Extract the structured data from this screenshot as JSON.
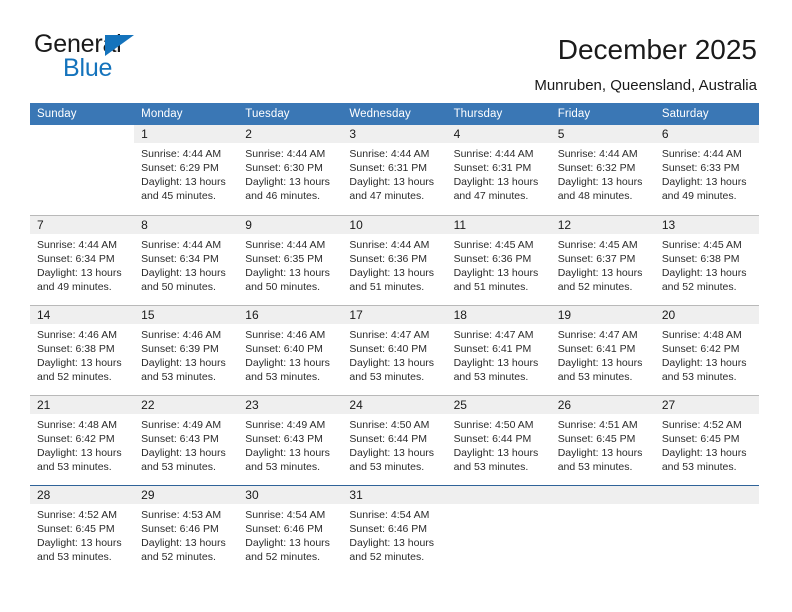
{
  "brand": {
    "name_top": "General",
    "name_bottom": "Blue",
    "triangle_color": "#1473bc"
  },
  "header": {
    "title": "December 2025",
    "location": "Munruben, Queensland, Australia",
    "accent_color": "#3a77b5"
  },
  "weekday_headers": [
    "Sunday",
    "Monday",
    "Tuesday",
    "Wednesday",
    "Thursday",
    "Friday",
    "Saturday"
  ],
  "labels": {
    "sunrise": "Sunrise:",
    "sunset": "Sunset:",
    "daylight": "Daylight:"
  },
  "weeks": [
    [
      {
        "day": "",
        "blank": true
      },
      {
        "day": "1",
        "sunrise": "Sunrise: 4:44 AM",
        "sunset": "Sunset: 6:29 PM",
        "daylight_1": "Daylight: 13 hours",
        "daylight_2": "and 45 minutes."
      },
      {
        "day": "2",
        "sunrise": "Sunrise: 4:44 AM",
        "sunset": "Sunset: 6:30 PM",
        "daylight_1": "Daylight: 13 hours",
        "daylight_2": "and 46 minutes."
      },
      {
        "day": "3",
        "sunrise": "Sunrise: 4:44 AM",
        "sunset": "Sunset: 6:31 PM",
        "daylight_1": "Daylight: 13 hours",
        "daylight_2": "and 47 minutes."
      },
      {
        "day": "4",
        "sunrise": "Sunrise: 4:44 AM",
        "sunset": "Sunset: 6:31 PM",
        "daylight_1": "Daylight: 13 hours",
        "daylight_2": "and 47 minutes."
      },
      {
        "day": "5",
        "sunrise": "Sunrise: 4:44 AM",
        "sunset": "Sunset: 6:32 PM",
        "daylight_1": "Daylight: 13 hours",
        "daylight_2": "and 48 minutes."
      },
      {
        "day": "6",
        "sunrise": "Sunrise: 4:44 AM",
        "sunset": "Sunset: 6:33 PM",
        "daylight_1": "Daylight: 13 hours",
        "daylight_2": "and 49 minutes."
      }
    ],
    [
      {
        "day": "7",
        "sunrise": "Sunrise: 4:44 AM",
        "sunset": "Sunset: 6:34 PM",
        "daylight_1": "Daylight: 13 hours",
        "daylight_2": "and 49 minutes."
      },
      {
        "day": "8",
        "sunrise": "Sunrise: 4:44 AM",
        "sunset": "Sunset: 6:34 PM",
        "daylight_1": "Daylight: 13 hours",
        "daylight_2": "and 50 minutes."
      },
      {
        "day": "9",
        "sunrise": "Sunrise: 4:44 AM",
        "sunset": "Sunset: 6:35 PM",
        "daylight_1": "Daylight: 13 hours",
        "daylight_2": "and 50 minutes."
      },
      {
        "day": "10",
        "sunrise": "Sunrise: 4:44 AM",
        "sunset": "Sunset: 6:36 PM",
        "daylight_1": "Daylight: 13 hours",
        "daylight_2": "and 51 minutes."
      },
      {
        "day": "11",
        "sunrise": "Sunrise: 4:45 AM",
        "sunset": "Sunset: 6:36 PM",
        "daylight_1": "Daylight: 13 hours",
        "daylight_2": "and 51 minutes."
      },
      {
        "day": "12",
        "sunrise": "Sunrise: 4:45 AM",
        "sunset": "Sunset: 6:37 PM",
        "daylight_1": "Daylight: 13 hours",
        "daylight_2": "and 52 minutes."
      },
      {
        "day": "13",
        "sunrise": "Sunrise: 4:45 AM",
        "sunset": "Sunset: 6:38 PM",
        "daylight_1": "Daylight: 13 hours",
        "daylight_2": "and 52 minutes."
      }
    ],
    [
      {
        "day": "14",
        "sunrise": "Sunrise: 4:46 AM",
        "sunset": "Sunset: 6:38 PM",
        "daylight_1": "Daylight: 13 hours",
        "daylight_2": "and 52 minutes."
      },
      {
        "day": "15",
        "sunrise": "Sunrise: 4:46 AM",
        "sunset": "Sunset: 6:39 PM",
        "daylight_1": "Daylight: 13 hours",
        "daylight_2": "and 53 minutes."
      },
      {
        "day": "16",
        "sunrise": "Sunrise: 4:46 AM",
        "sunset": "Sunset: 6:40 PM",
        "daylight_1": "Daylight: 13 hours",
        "daylight_2": "and 53 minutes."
      },
      {
        "day": "17",
        "sunrise": "Sunrise: 4:47 AM",
        "sunset": "Sunset: 6:40 PM",
        "daylight_1": "Daylight: 13 hours",
        "daylight_2": "and 53 minutes."
      },
      {
        "day": "18",
        "sunrise": "Sunrise: 4:47 AM",
        "sunset": "Sunset: 6:41 PM",
        "daylight_1": "Daylight: 13 hours",
        "daylight_2": "and 53 minutes."
      },
      {
        "day": "19",
        "sunrise": "Sunrise: 4:47 AM",
        "sunset": "Sunset: 6:41 PM",
        "daylight_1": "Daylight: 13 hours",
        "daylight_2": "and 53 minutes."
      },
      {
        "day": "20",
        "sunrise": "Sunrise: 4:48 AM",
        "sunset": "Sunset: 6:42 PM",
        "daylight_1": "Daylight: 13 hours",
        "daylight_2": "and 53 minutes."
      }
    ],
    [
      {
        "day": "21",
        "sunrise": "Sunrise: 4:48 AM",
        "sunset": "Sunset: 6:42 PM",
        "daylight_1": "Daylight: 13 hours",
        "daylight_2": "and 53 minutes."
      },
      {
        "day": "22",
        "sunrise": "Sunrise: 4:49 AM",
        "sunset": "Sunset: 6:43 PM",
        "daylight_1": "Daylight: 13 hours",
        "daylight_2": "and 53 minutes."
      },
      {
        "day": "23",
        "sunrise": "Sunrise: 4:49 AM",
        "sunset": "Sunset: 6:43 PM",
        "daylight_1": "Daylight: 13 hours",
        "daylight_2": "and 53 minutes."
      },
      {
        "day": "24",
        "sunrise": "Sunrise: 4:50 AM",
        "sunset": "Sunset: 6:44 PM",
        "daylight_1": "Daylight: 13 hours",
        "daylight_2": "and 53 minutes."
      },
      {
        "day": "25",
        "sunrise": "Sunrise: 4:50 AM",
        "sunset": "Sunset: 6:44 PM",
        "daylight_1": "Daylight: 13 hours",
        "daylight_2": "and 53 minutes."
      },
      {
        "day": "26",
        "sunrise": "Sunrise: 4:51 AM",
        "sunset": "Sunset: 6:45 PM",
        "daylight_1": "Daylight: 13 hours",
        "daylight_2": "and 53 minutes."
      },
      {
        "day": "27",
        "sunrise": "Sunrise: 4:52 AM",
        "sunset": "Sunset: 6:45 PM",
        "daylight_1": "Daylight: 13 hours",
        "daylight_2": "and 53 minutes."
      }
    ],
    [
      {
        "day": "28",
        "sunrise": "Sunrise: 4:52 AM",
        "sunset": "Sunset: 6:45 PM",
        "daylight_1": "Daylight: 13 hours",
        "daylight_2": "and 53 minutes."
      },
      {
        "day": "29",
        "sunrise": "Sunrise: 4:53 AM",
        "sunset": "Sunset: 6:46 PM",
        "daylight_1": "Daylight: 13 hours",
        "daylight_2": "and 52 minutes."
      },
      {
        "day": "30",
        "sunrise": "Sunrise: 4:54 AM",
        "sunset": "Sunset: 6:46 PM",
        "daylight_1": "Daylight: 13 hours",
        "daylight_2": "and 52 minutes."
      },
      {
        "day": "31",
        "sunrise": "Sunrise: 4:54 AM",
        "sunset": "Sunset: 6:46 PM",
        "daylight_1": "Daylight: 13 hours",
        "daylight_2": "and 52 minutes."
      },
      {
        "day": "",
        "empty": true
      },
      {
        "day": "",
        "empty": true
      },
      {
        "day": "",
        "empty": true
      }
    ]
  ]
}
